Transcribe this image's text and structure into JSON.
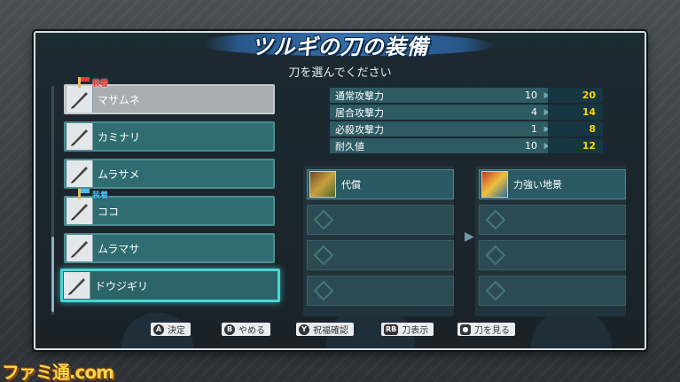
{
  "screen": {
    "title": "ツルギの刀の装備",
    "subtitle": "刀を選んでください"
  },
  "swords": [
    {
      "name": "マサムネ",
      "badge": "装着",
      "badge_color": "#e23c3c",
      "state": "equipped"
    },
    {
      "name": "カミナリ",
      "badge": "",
      "state": "normal"
    },
    {
      "name": "ムラサメ",
      "badge": "",
      "state": "normal"
    },
    {
      "name": "ココ",
      "badge": "装着",
      "badge_color": "#52b9f0",
      "state": "normal"
    },
    {
      "name": "ムラマサ",
      "badge": "",
      "state": "normal"
    },
    {
      "name": "ドウジギリ",
      "badge": "",
      "state": "selected"
    }
  ],
  "stats": [
    {
      "label": "通常攻撃力",
      "current": "10",
      "new": "20"
    },
    {
      "label": "居合攻撃力",
      "current": "4",
      "new": "14"
    },
    {
      "label": "必殺攻撃力",
      "current": "1",
      "new": "8"
    },
    {
      "label": "耐久値",
      "current": "10",
      "new": "12"
    }
  ],
  "skills": {
    "current": [
      "代償",
      "",
      "",
      ""
    ],
    "new": [
      "力強い地景",
      "",
      "",
      ""
    ]
  },
  "hints": [
    {
      "button": "A",
      "label": "決定"
    },
    {
      "button": "B",
      "label": "やめる"
    },
    {
      "button": "Y",
      "label": "祝福確認"
    },
    {
      "button": "RB",
      "label": "刀表示"
    },
    {
      "button": "●",
      "label": "刀を見る"
    }
  ],
  "watermark": "ファミ通.com",
  "colors": {
    "accent": "#49d6d6",
    "stat_new": "#ffd400",
    "panel": "#2f6d72"
  }
}
